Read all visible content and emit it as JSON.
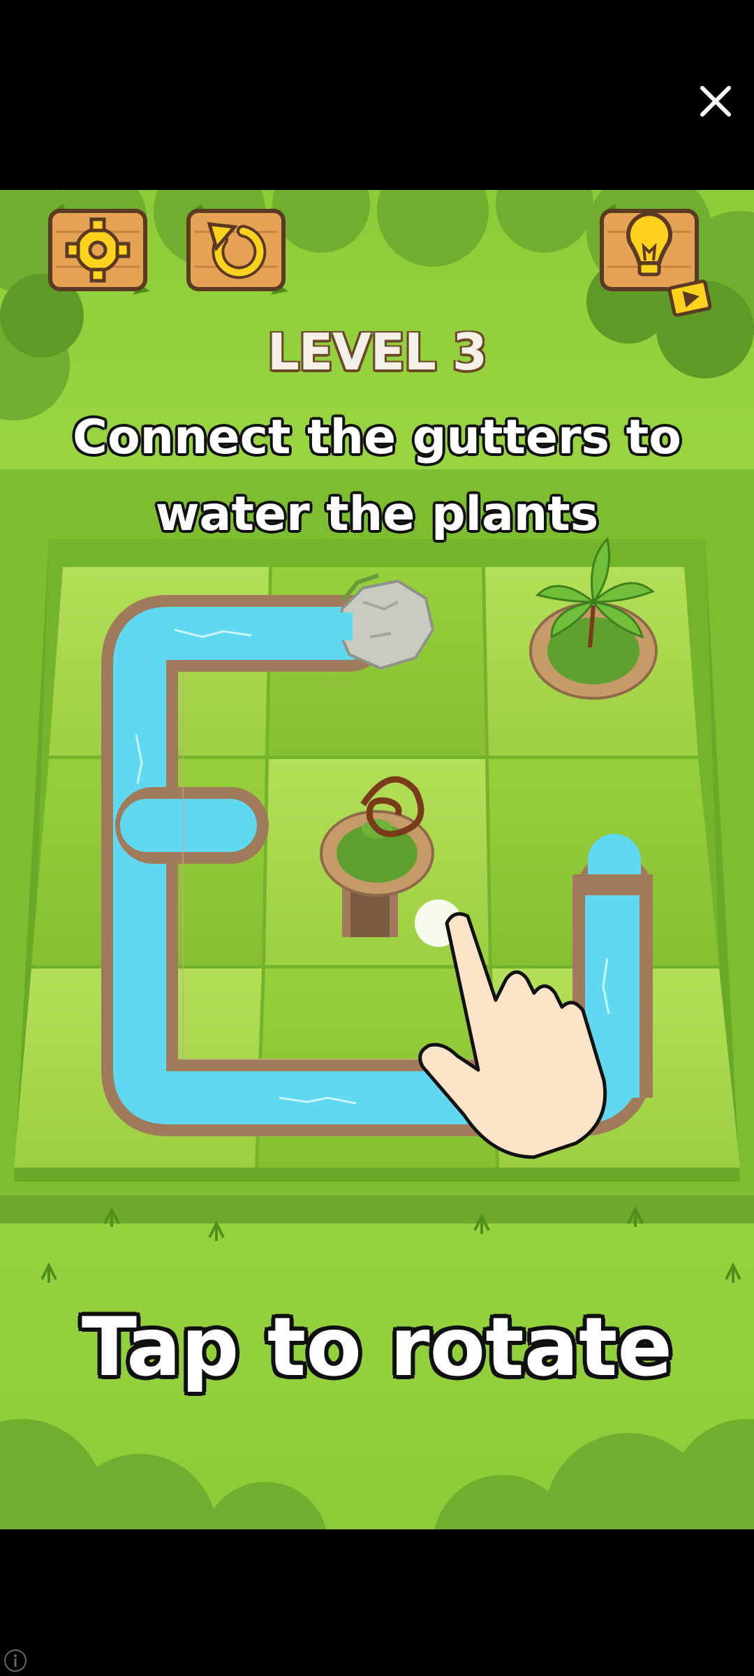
{
  "overlay": {
    "close_icon": "close-icon",
    "info_icon": "info-icon"
  },
  "toolbar": {
    "settings_icon": "gear-icon",
    "restart_icon": "restart-icon",
    "hint_icon": "lightbulb-icon",
    "hint_badge_icon": "video-play-icon"
  },
  "game": {
    "level_label": "LEVEL 3",
    "instruction_line1": "Connect the gutters to",
    "instruction_line2": "water the plants",
    "tutorial_text": "Tap to rotate",
    "tutorial_icon": "tap-hand-icon"
  },
  "board": {
    "rows": 3,
    "cols": 3,
    "tiles": [
      [
        "corner-start-right-down",
        "straight-end-with-rock",
        "plant-pot-down"
      ],
      [
        "corner-t-junction",
        "plant-pot-wilted-target",
        "straight-vertical"
      ],
      [
        "corner-up-right",
        "straight-horizontal",
        "corner-left-up"
      ]
    ]
  },
  "colors": {
    "grass": "#8ccc38",
    "tile_light": "#a8d84c",
    "water": "#5fd8f0",
    "wood": "#e6a355",
    "gutter_border": "#a07a5a"
  }
}
